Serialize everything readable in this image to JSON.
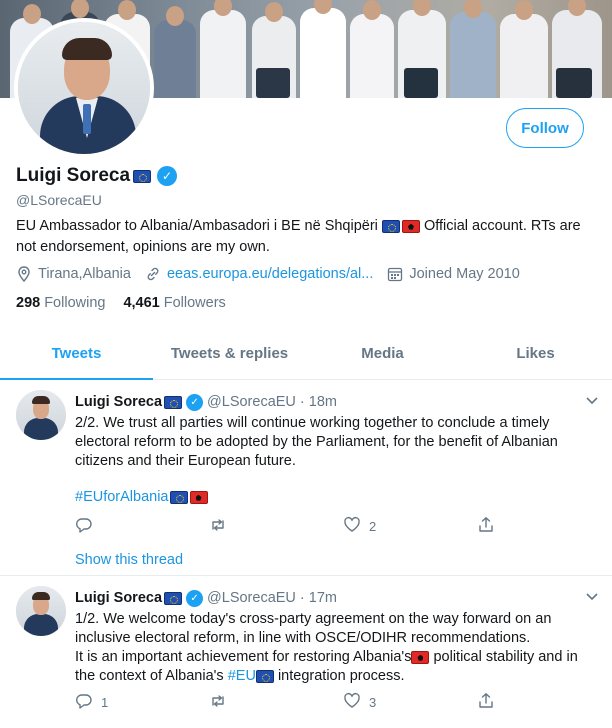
{
  "profile": {
    "display_name": "Luigi Soreca",
    "name_flag": "eu-flag",
    "verified_icon": "verified-badge-icon",
    "handle": "@LSorecaEU",
    "follow_label": "Follow",
    "bio_part1": "EU Ambassador to Albania/Ambasadori i BE në Shqipëri ",
    "bio_flags": [
      "eu-flag",
      "albania-flag"
    ],
    "bio_part2": " Official account. RTs are not endorsement, opinions are my own.",
    "location": "Tirana,Albania",
    "website": "eeas.europa.eu/delegations/al...",
    "joined": "Joined May 2010",
    "following_count": "298",
    "following_label": "Following",
    "followers_count": "4,461",
    "followers_label": "Followers"
  },
  "tabs": [
    {
      "label": "Tweets",
      "active": true
    },
    {
      "label": "Tweets & replies",
      "active": false
    },
    {
      "label": "Media",
      "active": false
    },
    {
      "label": "Likes",
      "active": false
    }
  ],
  "tweets": [
    {
      "name": "Luigi Soreca",
      "handle": "@LSorecaEU",
      "dot": "·",
      "time": "18m",
      "text": "2/2. We trust all parties will continue working together to conclude a timely electoral reform to be adopted by the Parliament, for the benefit of Albanian citizens and their European future.",
      "hashtag": "#EUforAlbania",
      "reply_count": "",
      "retweet_count": "",
      "like_count": "2",
      "show_thread": "Show this thread"
    },
    {
      "name": "Luigi Soreca",
      "handle": "@LSorecaEU",
      "dot": "·",
      "time": "17m",
      "text_line1": "1/2. We welcome today's cross-party agreement on the way forward on an inclusive electoral reform, in line with OSCE/ODIHR recommendations.",
      "text_line2a": "It is an important achievement for restoring Albania's",
      "text_line2b": " political stability and in the context of Albania's ",
      "hashtag": "#EU",
      "text_line2c": " integration process.",
      "reply_count": "1",
      "retweet_count": "",
      "like_count": "3"
    }
  ],
  "colors": {
    "accent": "#1da1f2",
    "link": "#1b95e0",
    "secondary_text": "#657786",
    "primary_text": "#14171a",
    "divider": "#e6ecf0"
  }
}
